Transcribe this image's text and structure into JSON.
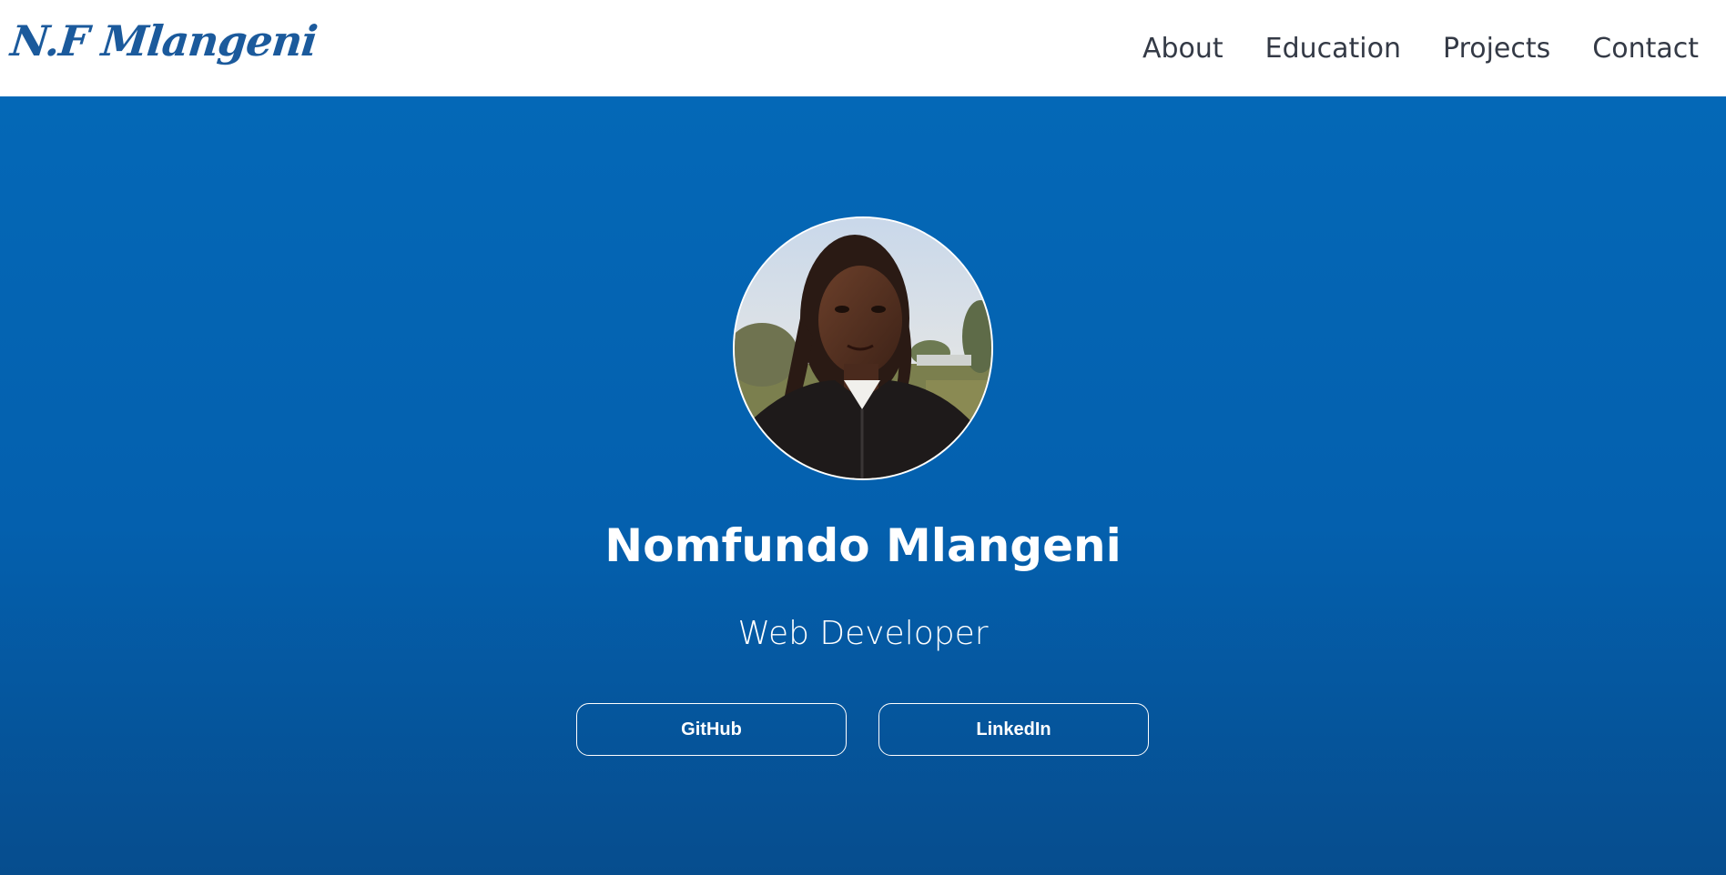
{
  "header": {
    "logo": "N.F Mlangeni",
    "nav": [
      {
        "label": "About"
      },
      {
        "label": "Education"
      },
      {
        "label": "Projects"
      },
      {
        "label": "Contact"
      }
    ]
  },
  "hero": {
    "name": "Nomfundo Mlangeni",
    "role": "Web Developer",
    "buttons": [
      {
        "label": "GitHub"
      },
      {
        "label": "LinkedIn"
      }
    ]
  },
  "colors": {
    "brand": "#1b5a9c",
    "hero_top": "#0468b7",
    "hero_bottom": "#064d8e",
    "nav_text": "#343a46"
  }
}
